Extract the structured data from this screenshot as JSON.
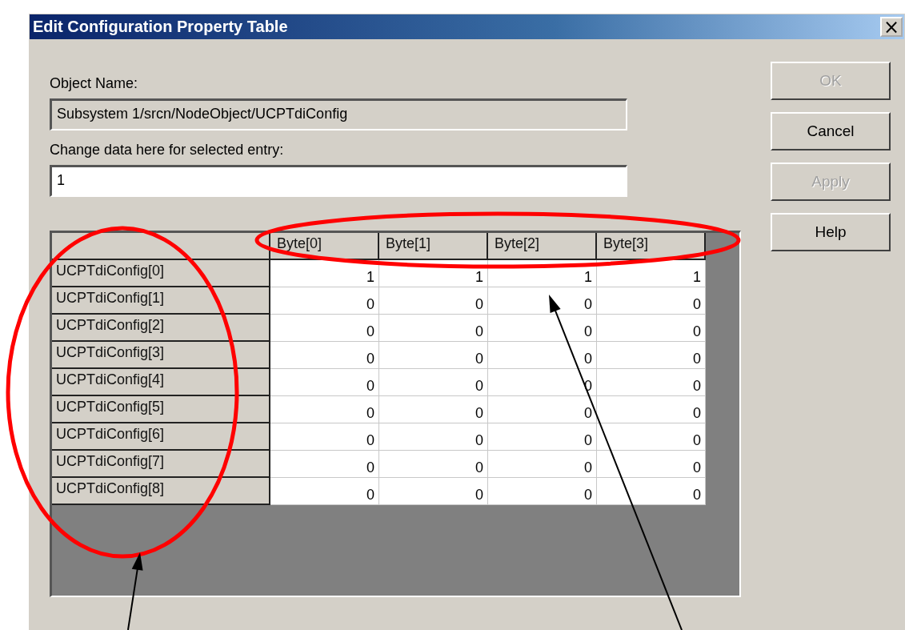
{
  "window": {
    "title": "Edit Configuration Property Table",
    "close": "×"
  },
  "object_name": {
    "label": "Object Name:",
    "value": "Subsystem 1/srcn/NodeObject/UCPTdiConfig"
  },
  "change_data": {
    "label": "Change data here for selected entry:",
    "value": "1"
  },
  "table": {
    "columns": [
      "Byte[0]",
      "Byte[1]",
      "Byte[2]",
      "Byte[3]"
    ],
    "rows": [
      {
        "label": "UCPTdiConfig[0]",
        "values": [
          "1",
          "1",
          "1",
          "1"
        ]
      },
      {
        "label": "UCPTdiConfig[1]",
        "values": [
          "0",
          "0",
          "0",
          "0"
        ]
      },
      {
        "label": "UCPTdiConfig[2]",
        "values": [
          "0",
          "0",
          "0",
          "0"
        ]
      },
      {
        "label": "UCPTdiConfig[3]",
        "values": [
          "0",
          "0",
          "0",
          "0"
        ]
      },
      {
        "label": "UCPTdiConfig[4]",
        "values": [
          "0",
          "0",
          "0",
          "0"
        ]
      },
      {
        "label": "UCPTdiConfig[5]",
        "values": [
          "0",
          "0",
          "0",
          "0"
        ]
      },
      {
        "label": "UCPTdiConfig[6]",
        "values": [
          "0",
          "0",
          "0",
          "0"
        ]
      },
      {
        "label": "UCPTdiConfig[7]",
        "values": [
          "0",
          "0",
          "0",
          "0"
        ]
      },
      {
        "label": "UCPTdiConfig[8]",
        "values": [
          "0",
          "0",
          "0",
          "0"
        ]
      }
    ]
  },
  "buttons": [
    {
      "label": "OK",
      "disabled": true
    },
    {
      "label": "Cancel",
      "disabled": false
    },
    {
      "label": "Apply",
      "disabled": true
    },
    {
      "label": "Help",
      "disabled": false
    }
  ],
  "callouts": [
    {
      "kind": "ellipse"
    },
    {
      "kind": "ellipse"
    },
    {
      "kind": "arrow"
    },
    {
      "kind": "arrow"
    }
  ]
}
